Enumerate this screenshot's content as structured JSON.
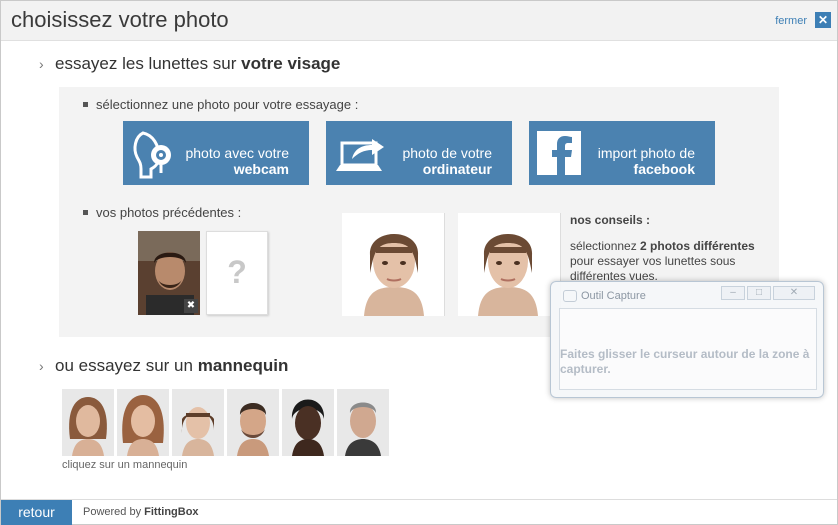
{
  "dialog": {
    "title": "choisissez votre photo",
    "close_label": "fermer",
    "close_glyph": "✕"
  },
  "face_section": {
    "heading_prefix": "essayez les lunettes sur ",
    "heading_bold": "votre visage",
    "select_label": "sélectionnez une photo pour votre essayage :",
    "buttons": [
      {
        "line1": "photo avec votre",
        "line2": "webcam",
        "icon": "webcam-icon"
      },
      {
        "line1": "photo de votre",
        "line2": "ordinateur",
        "icon": "computer-upload-icon"
      },
      {
        "line1": "import photo de",
        "line2": "facebook",
        "icon": "facebook-icon"
      }
    ],
    "previous_label": "vos photos précédentes :",
    "delete_glyph": "✖",
    "placeholder_glyph": "?",
    "tips_title": "nos conseils :",
    "tips_prefix": "sélectionnez ",
    "tips_bold": "2 photos différentes",
    "tips_rest": " pour essayer vos lunettes sous différentes vues."
  },
  "model_section": {
    "heading_prefix": "ou essayez sur un ",
    "heading_bold": "mannequin",
    "caption": "cliquez sur un mannequin"
  },
  "footer": {
    "back_label": "retour",
    "powered_prefix": "Powered by ",
    "powered_brand": "FittingBox"
  },
  "capture_tool": {
    "title": "Outil Capture",
    "message": "Faites glisser le curseur autour de la zone à capturer."
  },
  "colors": {
    "accent": "#3d7fb5",
    "button_bg": "#4b82b0",
    "panel_bg": "#f3f3f3"
  }
}
